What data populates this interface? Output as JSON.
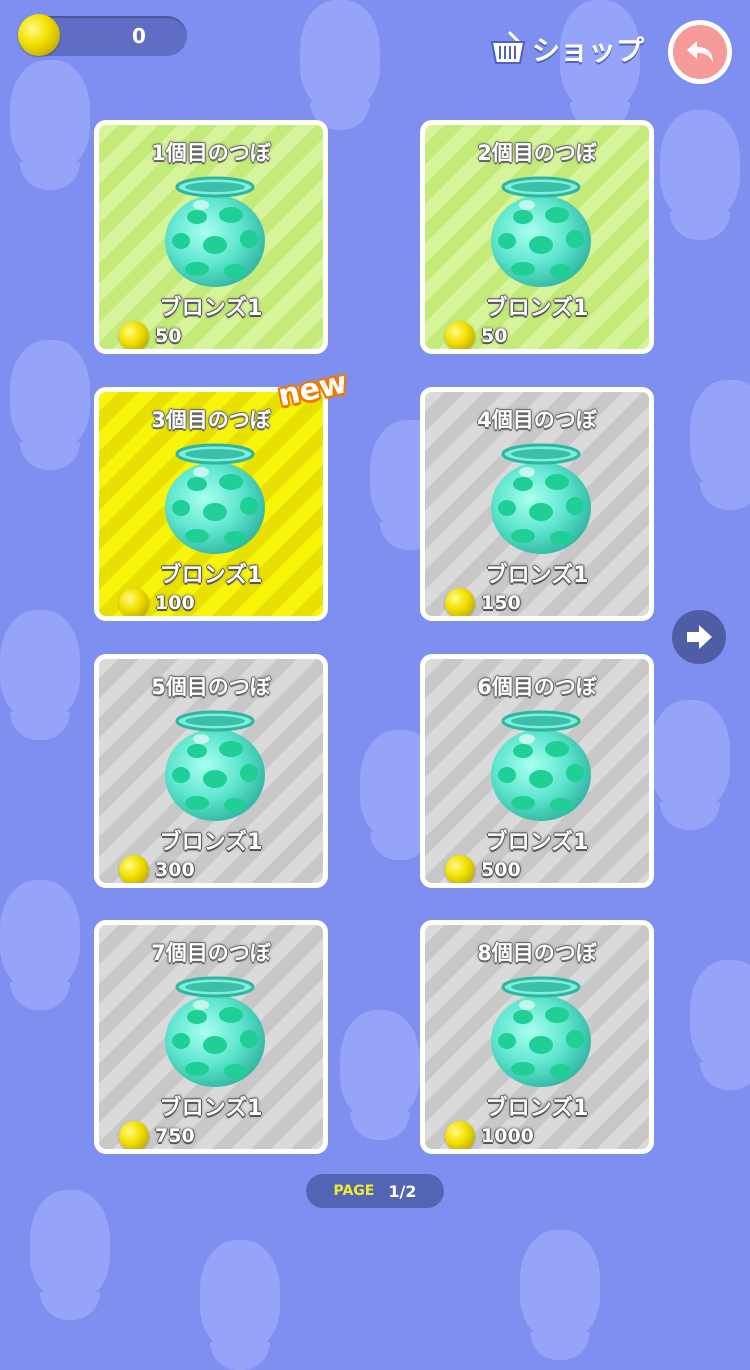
{
  "header": {
    "coin_count": "0",
    "shop_label": "ショップ"
  },
  "cards": [
    {
      "title": "1個目のつぼ",
      "rank": "ブロンズ1",
      "price": "50",
      "state": "green"
    },
    {
      "title": "2個目のつぼ",
      "rank": "ブロンズ1",
      "price": "50",
      "state": "green"
    },
    {
      "title": "3個目のつぼ",
      "rank": "ブロンズ1",
      "price": "100",
      "state": "yellow"
    },
    {
      "title": "4個目のつぼ",
      "rank": "ブロンズ1",
      "price": "150",
      "state": "gray"
    },
    {
      "title": "5個目のつぼ",
      "rank": "ブロンズ1",
      "price": "300",
      "state": "gray"
    },
    {
      "title": "6個目のつぼ",
      "rank": "ブロンズ1",
      "price": "500",
      "state": "gray"
    },
    {
      "title": "7個目のつぼ",
      "rank": "ブロンズ1",
      "price": "750",
      "state": "gray"
    },
    {
      "title": "8個目のつぼ",
      "rank": "ブロンズ1",
      "price": "1000",
      "state": "gray"
    }
  ],
  "new_badge": "new",
  "pager": {
    "label": "PAGE",
    "count": "1/2"
  },
  "icons": {
    "coin": "coin-icon",
    "shop": "basket-icon",
    "back": "back-arrow-icon",
    "next": "right-arrow-icon",
    "pot": "pot-icon"
  },
  "colors": {
    "background": "#7f8ff0",
    "card_green": "#d7f49a",
    "card_yellow": "#f8f40a",
    "card_gray": "#dadada",
    "accent_orange": "#f07a00",
    "back_button": "#f79a9a"
  }
}
